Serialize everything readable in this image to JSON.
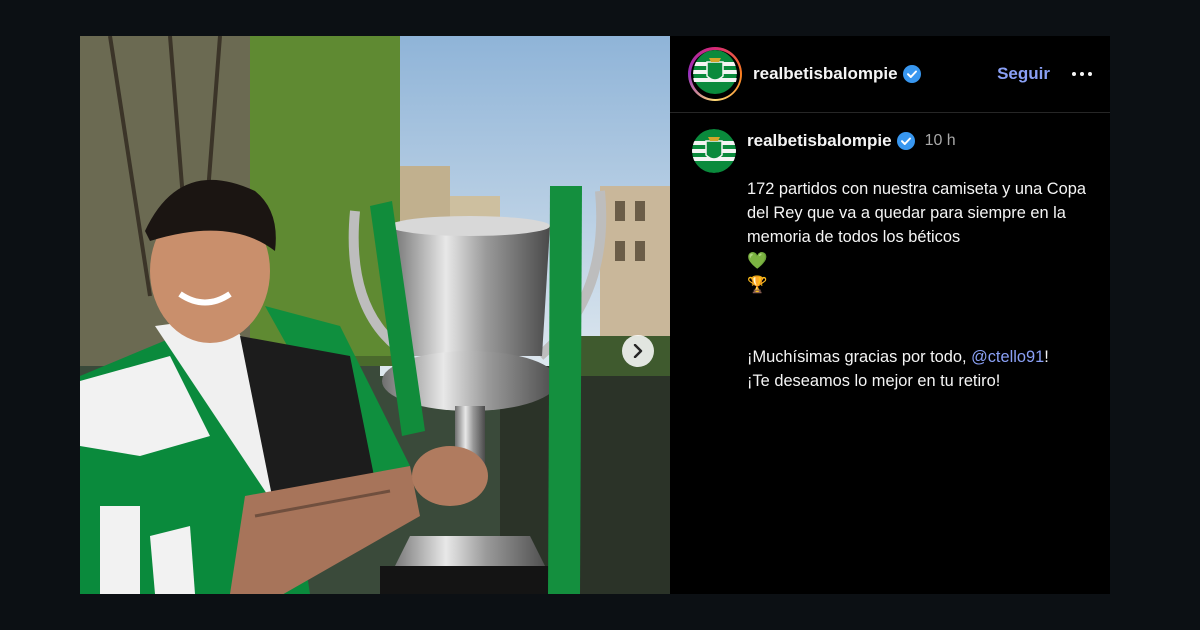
{
  "account": {
    "username": "realbetisbalompie",
    "follow_label": "Seguir"
  },
  "post": {
    "time": "10 h",
    "caption_line1": "172 partidos con nuestra camiseta y una Copa del Rey que va a quedar para siempre en la memoria de todos los béticos",
    "heart_emoji": "💚",
    "trophy_emoji": "🏆",
    "caption_line2_prefix": "¡Muchísimas gracias por todo, ",
    "mention": "@ctello91",
    "caption_line2_suffix": "!",
    "caption_line3": "¡Te deseamos lo mejor en tu retiro!"
  },
  "colors": {
    "link": "#8aa0f5",
    "verified": "#3897f0",
    "betis_green": "#0a8a3c"
  },
  "icons": {
    "verified": "verified-badge-icon",
    "next": "chevron-right-icon",
    "more": "more-options-icon"
  }
}
